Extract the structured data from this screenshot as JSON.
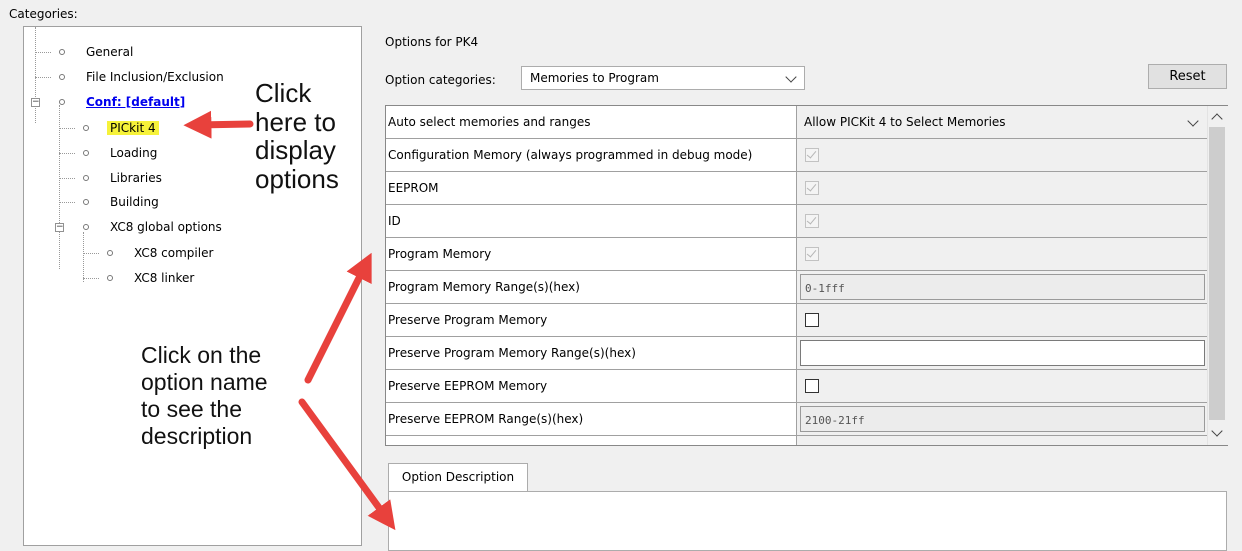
{
  "categories_label": "Categories:",
  "tree": {
    "general": "General",
    "file_inclusion": "File Inclusion/Exclusion",
    "conf": "Conf: [default]",
    "pickit": "PICkit 4",
    "loading": "Loading",
    "libraries": "Libraries",
    "building": "Building",
    "xc8_global": "XC8 global options",
    "xc8_compiler": "XC8 compiler",
    "xc8_linker": "XC8 linker"
  },
  "annotations": {
    "click_here_l1": "Click",
    "click_here_l2": "here to",
    "click_here_l3": "display",
    "click_here_l4": "options",
    "click_option_l1": "Click on the",
    "click_option_l2": "option name",
    "click_option_l3": "to see the",
    "click_option_l4": "description"
  },
  "options_for": "Options for PK4",
  "option_categories_label": "Option categories:",
  "option_categories_value": "Memories to Program",
  "reset_label": "Reset",
  "rows": [
    {
      "name": "Auto select memories and ranges",
      "value": "Allow PICKit 4 to Select Memories"
    },
    {
      "name": "Configuration Memory (always programmed in debug mode)",
      "checked": true
    },
    {
      "name": "EEPROM",
      "checked": true
    },
    {
      "name": "ID",
      "checked": true
    },
    {
      "name": "Program Memory",
      "checked": true
    },
    {
      "name": "Program Memory Range(s)(hex)",
      "value": "0-1fff"
    },
    {
      "name": "Preserve Program Memory",
      "checked": false
    },
    {
      "name": "Preserve Program Memory Range(s)(hex)",
      "value": ""
    },
    {
      "name": "Preserve EEPROM Memory",
      "checked": false
    },
    {
      "name": "Preserve EEPROM Range(s)(hex)",
      "value": "2100-21ff"
    }
  ],
  "description_tab": "Option Description",
  "colors": {
    "highlight": "#f6f23a",
    "link": "#0000ee",
    "arrow": "#e8413c"
  }
}
